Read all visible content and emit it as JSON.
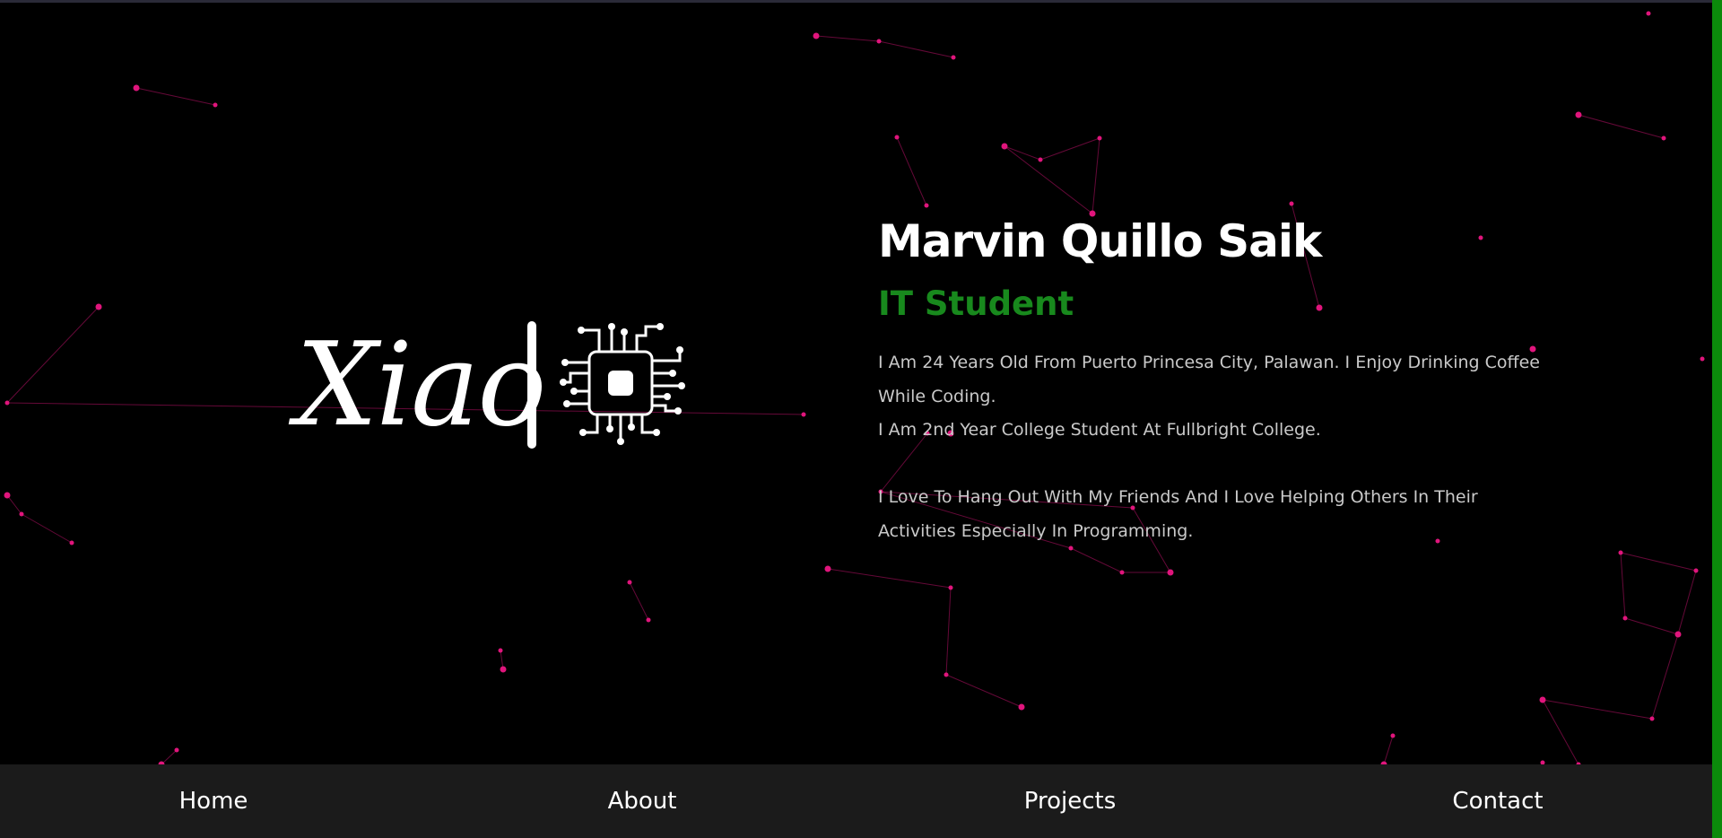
{
  "logo": {
    "text": "Xiao"
  },
  "profile": {
    "name": "Marvin Quillo Saik",
    "role": "IT Student",
    "bio": [
      "I Am 24 Years Old From Puerto Princesa City, Palawan. I Enjoy Drinking Coffee While Coding.",
      "I Am 2nd Year College Student At Fullbright College.",
      "I Love To Hang Out With My Friends And I Love Helping Others In Their Activities Especially In Programming."
    ]
  },
  "nav": {
    "items": [
      {
        "label": "Home"
      },
      {
        "label": "About"
      },
      {
        "label": "Projects"
      },
      {
        "label": "Contact"
      }
    ]
  },
  "colors": {
    "background": "#000000",
    "accent_green": "#18891d",
    "particle": "#e0157c",
    "navbar": "#1b1b1b",
    "scrollbar": "#0b8a0b"
  },
  "icons": {
    "logo_icon": "circuit-chip-icon"
  }
}
